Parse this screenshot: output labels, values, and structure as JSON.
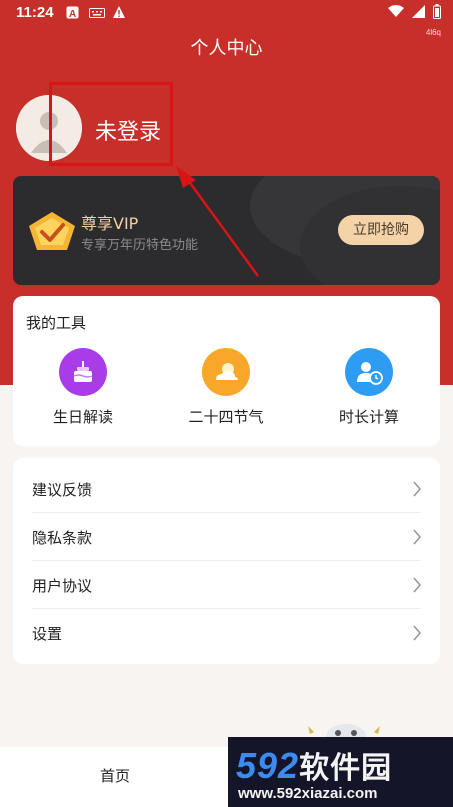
{
  "status_bar": {
    "time": "11:24",
    "device_id": "4l6q"
  },
  "header": {
    "title": "个人中心"
  },
  "profile": {
    "login_label": "未登录"
  },
  "vip": {
    "title": "尊享VIP",
    "subtitle": "专享万年历特色功能",
    "button_label": "立即抢购"
  },
  "tools": {
    "title": "我的工具",
    "items": [
      {
        "label": "生日解读",
        "icon": "cake-icon",
        "color": "#a93ce6"
      },
      {
        "label": "二十四节气",
        "icon": "sun-cloud-icon",
        "color": "#f8a72b"
      },
      {
        "label": "时长计算",
        "icon": "user-clock-icon",
        "color": "#2f9cf3"
      }
    ]
  },
  "menu": {
    "items": [
      {
        "label": "建议反馈"
      },
      {
        "label": "隐私条款"
      },
      {
        "label": "用户协议"
      },
      {
        "label": "设置"
      }
    ]
  },
  "bottom_nav": {
    "home_label": "首页"
  },
  "watermark": {
    "brand_num": "592",
    "brand_text": "软件园",
    "url": "www.592xiazai.com"
  },
  "colors": {
    "primary_red": "#c7302a",
    "vip_gold": "#f3cfa1",
    "annotation_red": "#d81414"
  }
}
